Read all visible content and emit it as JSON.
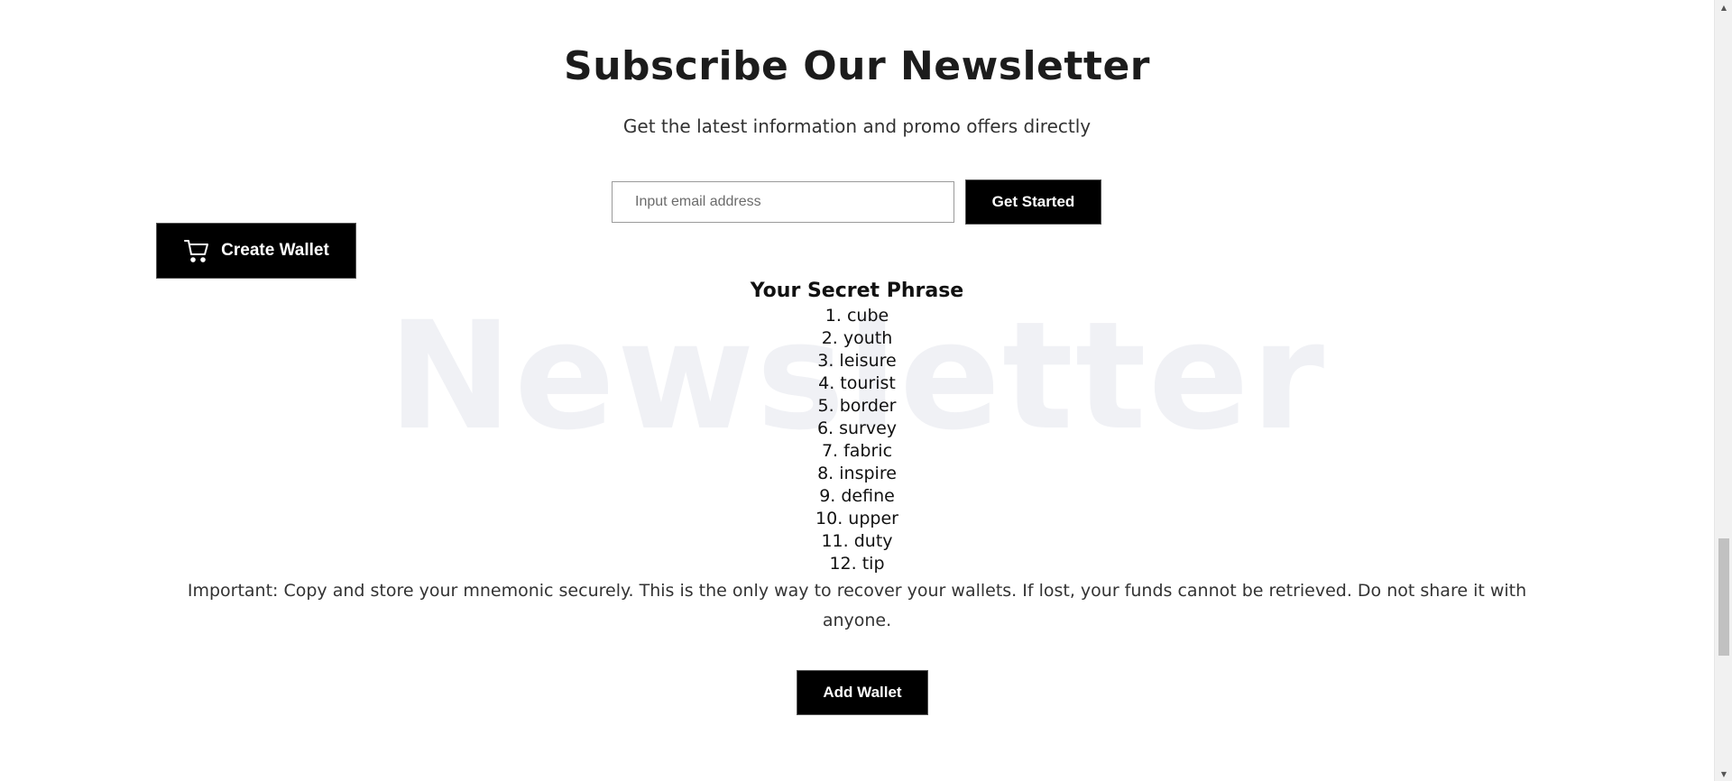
{
  "newsletter": {
    "title": "Subscribe Our Newsletter",
    "subtitle": "Get the latest information and promo offers directly",
    "email_placeholder": "Input email address",
    "submit_label": "Get Started",
    "watermark": "Newsletter"
  },
  "create_wallet": {
    "label": "Create Wallet",
    "icon": "cart-icon"
  },
  "secret_phrase": {
    "title": "Your Secret Phrase",
    "words": [
      "1. cube",
      "2. youth",
      "3. leisure",
      "4. tourist",
      "5. border",
      "6. survey",
      "7. fabric",
      "8. inspire",
      "9. define",
      "10. upper",
      "11. duty",
      "12. tip"
    ],
    "warning": "Important: Copy and store your mnemonic securely. This is the only way to recover your wallets. If lost, your funds cannot be retrieved. Do not share it with anyone."
  },
  "add_wallet": {
    "label": "Add Wallet"
  },
  "colors": {
    "button_bg": "#000000",
    "button_text": "#ffffff",
    "watermark": "#f0f1f5"
  }
}
